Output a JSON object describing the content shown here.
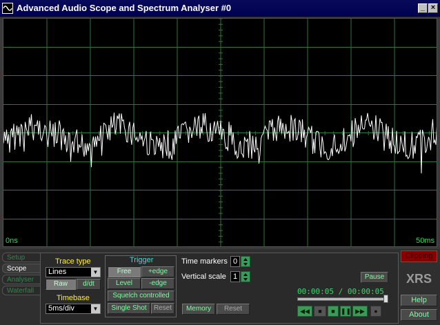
{
  "window": {
    "title": "Advanced Audio Scope and Spectrum Analyser #0"
  },
  "scope": {
    "start_label": "0ns",
    "end_label": "50ms",
    "grid_color": "#2a7a3a",
    "trace_color": "#ffffff"
  },
  "side_tabs": [
    "Setup",
    "Scope",
    "Analyser",
    "Waterfall"
  ],
  "trace_type": {
    "label": "Trace type",
    "value": "Lines",
    "btn_a": "Raw",
    "btn_b": "d/dt"
  },
  "timebase": {
    "label": "Timebase",
    "value": "5ms/div"
  },
  "trigger": {
    "title": "Trigger",
    "free": "Free",
    "pos_edge": "+edge",
    "level": "Level",
    "neg_edge": "-edge",
    "squelch": "Squelch controlled",
    "single_shot": "Single Shot",
    "reset": "Reset"
  },
  "time_markers": {
    "label": "Time markers",
    "value": "0"
  },
  "vertical_scale": {
    "label": "Vertical scale",
    "value": "1"
  },
  "memory": {
    "memory": "Memory",
    "reset": "Reset"
  },
  "transport": {
    "pause": "Pause",
    "timecode": "00:00:05 / 00:00:05",
    "position": 1.0,
    "buttons": [
      "rewind-icon",
      "record-icon",
      "stop-icon",
      "pause-icon",
      "fast-forward-icon",
      "dot-icon"
    ]
  },
  "right": {
    "clipping": "Clipping",
    "logo": "XRS",
    "help": "Help",
    "about": "About"
  }
}
